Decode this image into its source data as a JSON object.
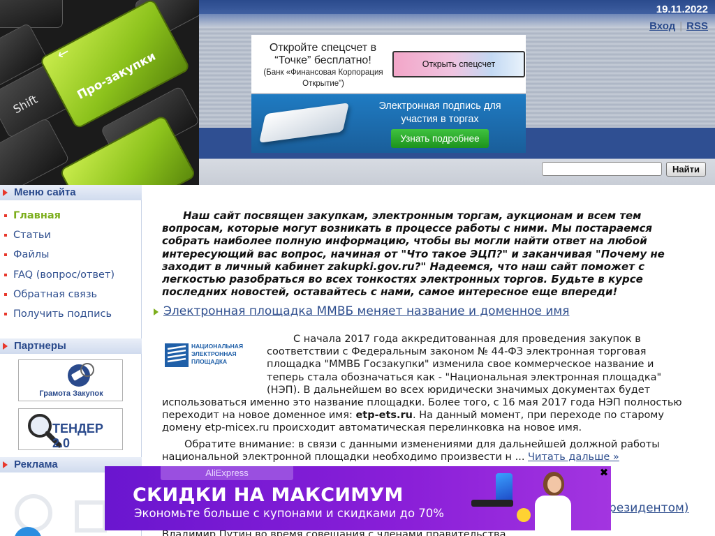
{
  "header": {
    "date": "19.11.2022",
    "links": {
      "login": "Вход",
      "separator": "|",
      "rss": "RSS"
    },
    "keyboard": {
      "green_key_label": "Про-закупки",
      "shift_key_label": "Shift"
    }
  },
  "ads": {
    "bank": {
      "title": "Откройте спецсчет в “Точке” бесплатно!",
      "subtitle": "(Банк «Финансовая Корпорация Открытие”)",
      "button": "Открыть спецсчет"
    },
    "signature": {
      "title": "Электронная подпись для участия в торгах",
      "button": "Узнать подробнее"
    },
    "popup": {
      "brand": "AliExpress",
      "headline": "СКИДКИ НА МАКСИМУМ",
      "subline": "Экономьте больше с купонами и скидками до 70%",
      "close": "✖"
    }
  },
  "search": {
    "placeholder": "",
    "button": "Найти"
  },
  "sidebar": {
    "menu_title": "Меню сайта",
    "menu": [
      {
        "label": "Главная",
        "active": true
      },
      {
        "label": "Статьи"
      },
      {
        "label": "Файлы"
      },
      {
        "label": "FAQ (вопрос/ответ)"
      },
      {
        "label": "Обратная связь"
      },
      {
        "label": "Получить подпись"
      }
    ],
    "partners_title": "Партнеры",
    "partners": [
      {
        "label": "Грамота Закупок"
      },
      {
        "label": "ТЕНДЕР 2.0"
      }
    ],
    "ads_title": "Реклама"
  },
  "main": {
    "intro": "Наш сайт посвящен закупкам, электронным торгам, аукционам и всем тем вопросам, которые могут возникать в процессе работы с ними. Мы постараемся собрать наиболее полную информацию, чтобы вы могли найти ответ на любой интересующий вас вопрос, начиная от \"Что такое ЭЦП?\" и заканчивая \"Почему не заходит в личный кабинет zakupki.gov.ru?\" Надеемся, что наш сайт поможет с легкостью разобраться во всех тонкостях электронных торгов. Будьте в курсе последних новостей, оставайтесь с нами, самое интересное еще впереди!",
    "article": {
      "title": "Электронная площадка ММВБ меняет название и доменное имя",
      "logo_text": "НАЦИОНАЛЬНАЯ ЭЛЕКТРОННАЯ ПЛОЩАДКА",
      "p1_a": "С начала 2017 года аккредитованная для проведения закупок в соответствии с Федеральным законом № 44-ФЗ электронная торговая площадка \"ММВБ Госзакупки\" изменила свое коммерческое название и теперь стала обозначаться как - \"Национальная электронная площадка\" (НЭП). В дальнейшем во всех юридически значимых документах будет использоваться именно это название площадки. Более того, с 16 мая 2017 года НЭП полностью переходит на новое доменное имя: ",
      "p1_domain": "etp-ets.ru",
      "p1_b": ". На данный момент, при переходе по старому домену etp-micex.ru происходит автоматическая перелинковка на новое имя.",
      "p2": "Обратите внимание: в связи с данными изменениями для дальнейшей должной работы национальной электронной площадки необходимо произвести н ... ",
      "read_more": "Читать дальше »"
    },
    "second_title_tail": "резидентом)",
    "faded_line": "Владимир Путин во время совещания с членами правительства"
  }
}
